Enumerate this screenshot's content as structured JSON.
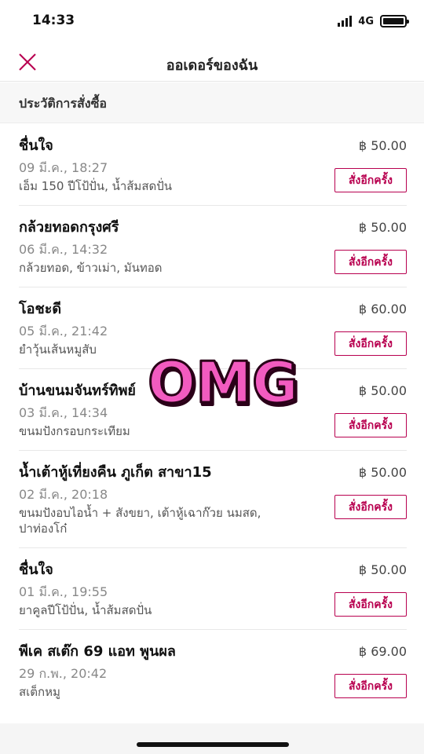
{
  "status_bar": {
    "time": "14:33",
    "network": "4G"
  },
  "header": {
    "title": "ออเดอร์ของฉัน"
  },
  "section": {
    "title": "ประวัติการสั่งซื้อ"
  },
  "reorder_label": "สั่งอีกครั้ง",
  "orders": [
    {
      "name": "ชื่นใจ",
      "date": "09 มี.ค., 18:27",
      "items": "เอ็ม 150 ปีโป้ปั่น, น้ำส้มสดปั่น",
      "price": "฿ 50.00"
    },
    {
      "name": "กล้วยทอดกรุงศรี",
      "date": "06 มี.ค., 14:32",
      "items": "กล้วยทอด, ข้าวเม่า, มันทอด",
      "price": "฿ 50.00"
    },
    {
      "name": "โอชะดี",
      "date": "05 มี.ค., 21:42",
      "items": "ยำวุ้นเส้นหมูสับ",
      "price": "฿ 60.00"
    },
    {
      "name": "บ้านขนมจันทร์ทิพย์",
      "date": "03 มี.ค., 14:34",
      "items": "ขนมปังกรอบกระเทียม",
      "price": "฿ 50.00"
    },
    {
      "name": "น้ำเต้าหู้เที่ยงคืน ภูเก็ต สาขา15",
      "date": "02 มี.ค., 20:18",
      "items": "ขนมปังอบไอน้ำ + สังขยา, เต้าหู้เฉาก๊วย นมสด, ปาท่องโก๋",
      "price": "฿ 50.00"
    },
    {
      "name": "ชื่นใจ",
      "date": "01 มี.ค., 19:55",
      "items": "ยาคูลปีโป้ปั่น, น้ำส้มสดปั่น",
      "price": "฿ 50.00"
    },
    {
      "name": "พีเค สเต๊ก 69 แอท พูนผล",
      "date": "29 ก.พ., 20:42",
      "items": "สเต็กหมู",
      "price": "฿ 69.00"
    }
  ],
  "sticker": {
    "text": "OMG"
  },
  "colors": {
    "accent": "#b8004f",
    "sticker_pink": "#f25bc0"
  },
  "icons": {
    "close": "close-icon",
    "battery": "battery-icon",
    "signal": "signal-icon"
  }
}
